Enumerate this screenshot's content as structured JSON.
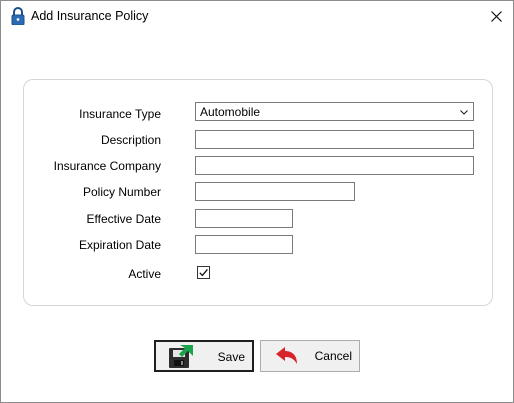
{
  "window": {
    "title": "Add Insurance Policy",
    "title_icon": "padlock-icon",
    "close_icon": "close-icon"
  },
  "form": {
    "insurance_type": {
      "label": "Insurance Type",
      "value": "Automobile"
    },
    "description": {
      "label": "Description",
      "value": ""
    },
    "insurance_company": {
      "label": "Insurance Company",
      "value": ""
    },
    "policy_number": {
      "label": "Policy Number",
      "value": ""
    },
    "effective_date": {
      "label": "Effective Date",
      "value": ""
    },
    "expiration_date": {
      "label": "Expiration Date",
      "value": ""
    },
    "active": {
      "label": "Active",
      "checked": true
    }
  },
  "buttons": {
    "save": {
      "label": "Save",
      "icon": "floppy-disk-icon"
    },
    "cancel": {
      "label": "Cancel",
      "icon": "undo-arrow-icon"
    }
  },
  "colors": {
    "accent_green": "#1aa34a",
    "cancel_red": "#d8232a",
    "save_dark": "#333333"
  }
}
